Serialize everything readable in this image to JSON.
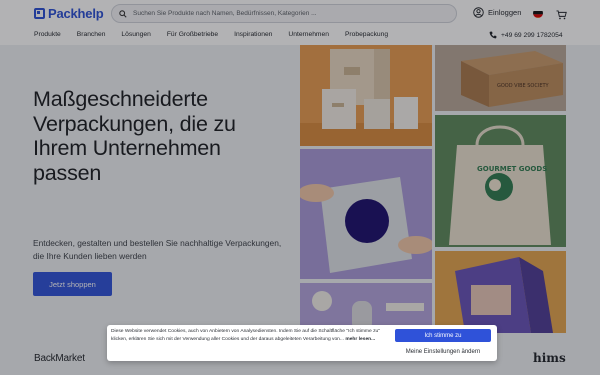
{
  "header": {
    "logo_text": "Packhelp",
    "search_placeholder": "Suchen Sie Produkte nach Namen, Bedürfnissen, Kategorien ...",
    "login_label": "Einloggen",
    "language_flag": "flag-de-icon",
    "phone": "+49 69 299 1782054"
  },
  "nav": {
    "items": [
      {
        "label": "Produkte"
      },
      {
        "label": "Branchen"
      },
      {
        "label": "Lösungen"
      },
      {
        "label": "Für Großbetriebe"
      },
      {
        "label": "Inspirationen"
      },
      {
        "label": "Unternehmen"
      },
      {
        "label": "Probepackung"
      }
    ]
  },
  "hero": {
    "headline": "Maßgeschneiderte Verpackungen, die zu Ihrem Unternehmen passen",
    "subline": "Entdecken, gestalten und bestellen Sie nachhaltige Verpackungen, die Ihre Kunden lieben werden",
    "cta_label": "Jetzt shoppen"
  },
  "images": {
    "candle_box": "candle-packaging-image",
    "kraft_box": "kraft-mailer-box-image",
    "mailer_bag": "poly-mailer-image",
    "tote_bag": "tote-bag-image",
    "tote_bag_text": "GOURMET GOODS",
    "product_shot": "product-packaging-image",
    "cereal_box": "cereal-box-image",
    "box_print_text": "GOOD VIBE SOCIETY"
  },
  "brands": {
    "left": "BackMarket",
    "right": "hims"
  },
  "cookie": {
    "text": "Diese Website verwendet Cookies, auch von Anbietern von Analysediensten. Indem Sie auf die Schaltfläche \"Ich stimme zu\" klicken, erklären Sie sich mit der Verwendung aller Cookies und der daraus abgeleiteten Verarbeitung von...",
    "more_label": "mehr lesen...",
    "accept_label": "Ich stimme zu",
    "settings_label": "Meine Einstellungen ändern"
  },
  "colors": {
    "brand_blue": "#2f52d9",
    "overlay": "rgba(20,22,28,0.33)"
  }
}
